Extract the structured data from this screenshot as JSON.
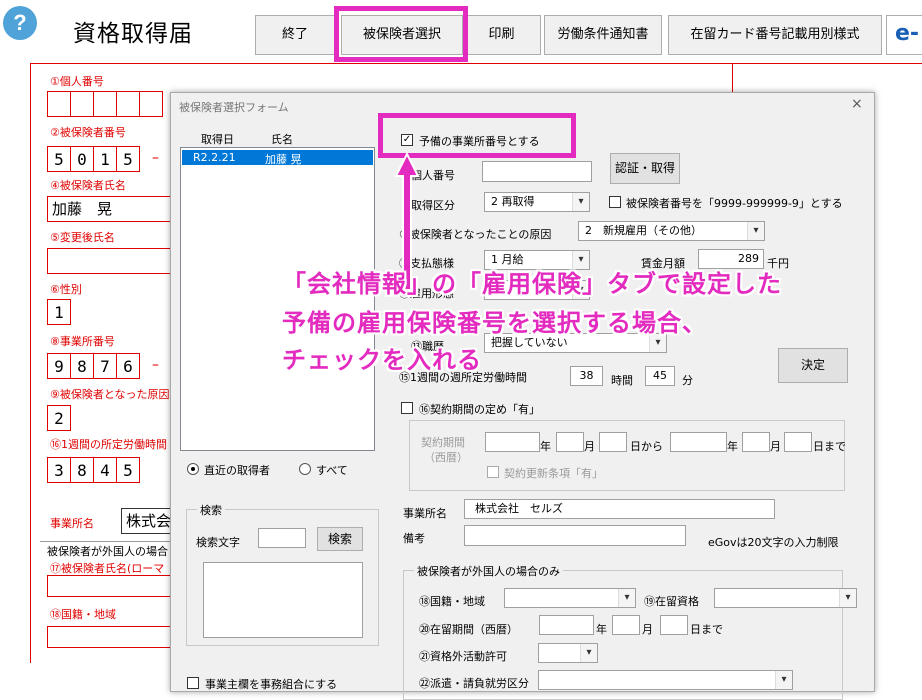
{
  "header": {
    "help_icon": "?",
    "title": "資格取得届",
    "buttons": [
      "終了",
      "被保険者選択",
      "印刷",
      "労働条件通知書",
      "在留カード番号記載用別様式"
    ],
    "egov_logo": "e-G"
  },
  "form": {
    "individual_number": "①個人番号",
    "insured_number": "②被保険者番号",
    "insured_digits": [
      "5",
      "0",
      "1",
      "5"
    ],
    "insured_name": "④被保険者氏名",
    "insured_name_value": "加藤　晃",
    "changed_name": "⑤変更後氏名",
    "gender": "⑥性別",
    "gender_value": "1",
    "office_number": "⑧事業所番号",
    "office_digits": [
      "9",
      "8",
      "7",
      "6"
    ],
    "cause": "⑨被保険者となった原因",
    "cause_value": "2",
    "weekly_hours": "⑯1週間の所定労働時間",
    "hours_digits": [
      "3",
      "8",
      "4",
      "5"
    ],
    "office_name": "事業所名",
    "office_name_value": "株式会",
    "foreign_caption": "被保険者が外国人の場合",
    "foreign_name": "⑰被保険者氏名(ローマ",
    "nationality": "⑱国籍・地域"
  },
  "dialog": {
    "title": "被保険者選択フォーム",
    "close": "×",
    "list_headers": [
      "取得日",
      "氏名"
    ],
    "list_rows": [
      {
        "date": "R2.2.21",
        "name": "加藤 晃"
      }
    ],
    "spare_office_checkbox": "予備の事業所番号とする",
    "individual_number": "個人番号",
    "auth_button": "認証・取得",
    "acquisition_type": "取得区分",
    "acquisition_type_value": "2 再取得",
    "insured_number_check": "被保険者番号を「9999-999999-9」とする",
    "cause_label": "⑤被保険者となったことの原因",
    "cause_value": "2　新規雇用（その他）",
    "payment_label": "⑪支払態様",
    "payment_value": "1 月給",
    "wage_label": "賃金月額",
    "wage_value": "289",
    "wage_unit": "千円",
    "employment_form_label": "⑫雇用形態",
    "career_label": "⑬職歴",
    "career_value": "把握していない",
    "decide_button": "決定",
    "hours_label": "⑮1週間の週所定労働時間",
    "hours_value": "38",
    "hours_unit": "時間",
    "minutes_value": "45",
    "minutes_unit": "分",
    "contract_check": "⑯契約期間の定め「有」",
    "contract_period": "契約期間",
    "seireki": "（西暦）",
    "year": "年",
    "month": "月",
    "from": "日から",
    "until": "日まで",
    "renewal_check": "契約更新条項「有」",
    "radio_recent": "直近の取得者",
    "radio_all": "すべて",
    "search_group": "検索",
    "search_text_label": "検索文字",
    "search_button": "検索",
    "office_name_label": "事業所名",
    "office_name_value": "株式会社　セルズ",
    "remarks_label": "備考",
    "egov_limit": "eGovは20文字の入力制限",
    "foreign_group": "被保険者が外国人の場合のみ",
    "nationality_label": "⑱国籍・地域",
    "residence_status_label": "⑲在留資格",
    "residence_period_label": "⑳在留期間（西暦）",
    "year2": "年",
    "month2": "月",
    "until2": "日まで",
    "extra_activity_label": "㉑資格外活動許可",
    "dispatch_label": "㉒派遣・請負就労区分",
    "bottom_check": "事業主欄を事務組合にする"
  },
  "annotation": {
    "lines": [
      "「会社情報」の「雇用保険」タブで設定した",
      "予備の雇用保険番号を選択する場合、",
      "チェックを入れる"
    ]
  },
  "colors": {
    "highlight": "#e32bbf",
    "form_red": "#e00000",
    "selection": "#0078d7"
  }
}
